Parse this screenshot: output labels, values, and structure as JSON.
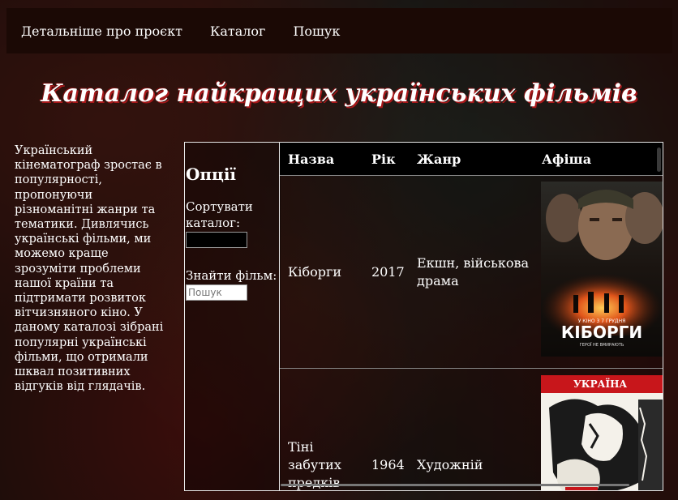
{
  "nav": {
    "items": [
      {
        "label": "Детальніше про проєкт"
      },
      {
        "label": "Каталог"
      },
      {
        "label": "Пошук"
      }
    ]
  },
  "page_title": "Каталог найкращих українських фільмів",
  "intro_text": "Український кінематограф зростає в популярності, пропонуючи різноманітні жанри та тематики. Дивлячись українські фільми, ми можемо краще зрозуміти проблеми нашої країни та підтримати розвиток вітчизняного кіно. У даному каталозі зібрані популярні українські фільми, що отримали шквал позитивних відгуків від глядачів.",
  "options": {
    "title": "Опції",
    "sort_label": "Сортувати каталог:",
    "sort_value": "",
    "find_label": "Знайти фільм:",
    "search_placeholder": "Пошук"
  },
  "catalog": {
    "columns": [
      "Назва",
      "Рік",
      "Жанр",
      "Афіша"
    ],
    "rows": [
      {
        "name": "Кіборги",
        "year": "2017",
        "genre": "Екшн, військова драма",
        "poster": {
          "top_text": "У КІНО З 7 ГРУДНЯ",
          "title": "КІБОРГИ",
          "subtitle": "ГЕРОЇ НЕ ВМИРАЮТЬ"
        }
      },
      {
        "name": "Тіні забутих предків",
        "year": "1964",
        "genre": "Художній",
        "poster": {
          "title": "УКРАЇНА"
        }
      }
    ]
  },
  "colors": {
    "navbar_bg": "#1b0905",
    "title_shadow": "#a8181a",
    "table_border": "#e8e8e8"
  }
}
